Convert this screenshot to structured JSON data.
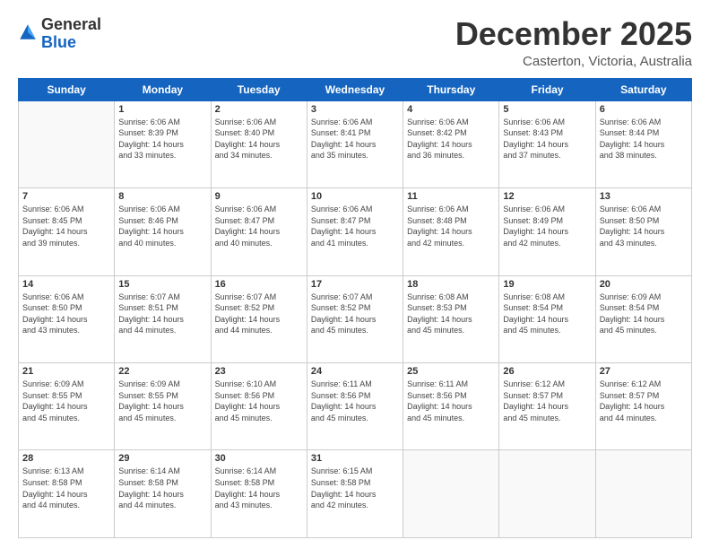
{
  "logo": {
    "general": "General",
    "blue": "Blue"
  },
  "header": {
    "month": "December 2025",
    "location": "Casterton, Victoria, Australia"
  },
  "weekdays": [
    "Sunday",
    "Monday",
    "Tuesday",
    "Wednesday",
    "Thursday",
    "Friday",
    "Saturday"
  ],
  "weeks": [
    [
      {
        "day": "",
        "info": ""
      },
      {
        "day": "1",
        "info": "Sunrise: 6:06 AM\nSunset: 8:39 PM\nDaylight: 14 hours\nand 33 minutes."
      },
      {
        "day": "2",
        "info": "Sunrise: 6:06 AM\nSunset: 8:40 PM\nDaylight: 14 hours\nand 34 minutes."
      },
      {
        "day": "3",
        "info": "Sunrise: 6:06 AM\nSunset: 8:41 PM\nDaylight: 14 hours\nand 35 minutes."
      },
      {
        "day": "4",
        "info": "Sunrise: 6:06 AM\nSunset: 8:42 PM\nDaylight: 14 hours\nand 36 minutes."
      },
      {
        "day": "5",
        "info": "Sunrise: 6:06 AM\nSunset: 8:43 PM\nDaylight: 14 hours\nand 37 minutes."
      },
      {
        "day": "6",
        "info": "Sunrise: 6:06 AM\nSunset: 8:44 PM\nDaylight: 14 hours\nand 38 minutes."
      }
    ],
    [
      {
        "day": "7",
        "info": "Sunrise: 6:06 AM\nSunset: 8:45 PM\nDaylight: 14 hours\nand 39 minutes."
      },
      {
        "day": "8",
        "info": "Sunrise: 6:06 AM\nSunset: 8:46 PM\nDaylight: 14 hours\nand 40 minutes."
      },
      {
        "day": "9",
        "info": "Sunrise: 6:06 AM\nSunset: 8:47 PM\nDaylight: 14 hours\nand 40 minutes."
      },
      {
        "day": "10",
        "info": "Sunrise: 6:06 AM\nSunset: 8:47 PM\nDaylight: 14 hours\nand 41 minutes."
      },
      {
        "day": "11",
        "info": "Sunrise: 6:06 AM\nSunset: 8:48 PM\nDaylight: 14 hours\nand 42 minutes."
      },
      {
        "day": "12",
        "info": "Sunrise: 6:06 AM\nSunset: 8:49 PM\nDaylight: 14 hours\nand 42 minutes."
      },
      {
        "day": "13",
        "info": "Sunrise: 6:06 AM\nSunset: 8:50 PM\nDaylight: 14 hours\nand 43 minutes."
      }
    ],
    [
      {
        "day": "14",
        "info": "Sunrise: 6:06 AM\nSunset: 8:50 PM\nDaylight: 14 hours\nand 43 minutes."
      },
      {
        "day": "15",
        "info": "Sunrise: 6:07 AM\nSunset: 8:51 PM\nDaylight: 14 hours\nand 44 minutes."
      },
      {
        "day": "16",
        "info": "Sunrise: 6:07 AM\nSunset: 8:52 PM\nDaylight: 14 hours\nand 44 minutes."
      },
      {
        "day": "17",
        "info": "Sunrise: 6:07 AM\nSunset: 8:52 PM\nDaylight: 14 hours\nand 45 minutes."
      },
      {
        "day": "18",
        "info": "Sunrise: 6:08 AM\nSunset: 8:53 PM\nDaylight: 14 hours\nand 45 minutes."
      },
      {
        "day": "19",
        "info": "Sunrise: 6:08 AM\nSunset: 8:54 PM\nDaylight: 14 hours\nand 45 minutes."
      },
      {
        "day": "20",
        "info": "Sunrise: 6:09 AM\nSunset: 8:54 PM\nDaylight: 14 hours\nand 45 minutes."
      }
    ],
    [
      {
        "day": "21",
        "info": "Sunrise: 6:09 AM\nSunset: 8:55 PM\nDaylight: 14 hours\nand 45 minutes."
      },
      {
        "day": "22",
        "info": "Sunrise: 6:09 AM\nSunset: 8:55 PM\nDaylight: 14 hours\nand 45 minutes."
      },
      {
        "day": "23",
        "info": "Sunrise: 6:10 AM\nSunset: 8:56 PM\nDaylight: 14 hours\nand 45 minutes."
      },
      {
        "day": "24",
        "info": "Sunrise: 6:11 AM\nSunset: 8:56 PM\nDaylight: 14 hours\nand 45 minutes."
      },
      {
        "day": "25",
        "info": "Sunrise: 6:11 AM\nSunset: 8:56 PM\nDaylight: 14 hours\nand 45 minutes."
      },
      {
        "day": "26",
        "info": "Sunrise: 6:12 AM\nSunset: 8:57 PM\nDaylight: 14 hours\nand 45 minutes."
      },
      {
        "day": "27",
        "info": "Sunrise: 6:12 AM\nSunset: 8:57 PM\nDaylight: 14 hours\nand 44 minutes."
      }
    ],
    [
      {
        "day": "28",
        "info": "Sunrise: 6:13 AM\nSunset: 8:58 PM\nDaylight: 14 hours\nand 44 minutes."
      },
      {
        "day": "29",
        "info": "Sunrise: 6:14 AM\nSunset: 8:58 PM\nDaylight: 14 hours\nand 44 minutes."
      },
      {
        "day": "30",
        "info": "Sunrise: 6:14 AM\nSunset: 8:58 PM\nDaylight: 14 hours\nand 43 minutes."
      },
      {
        "day": "31",
        "info": "Sunrise: 6:15 AM\nSunset: 8:58 PM\nDaylight: 14 hours\nand 42 minutes."
      },
      {
        "day": "",
        "info": ""
      },
      {
        "day": "",
        "info": ""
      },
      {
        "day": "",
        "info": ""
      }
    ]
  ]
}
